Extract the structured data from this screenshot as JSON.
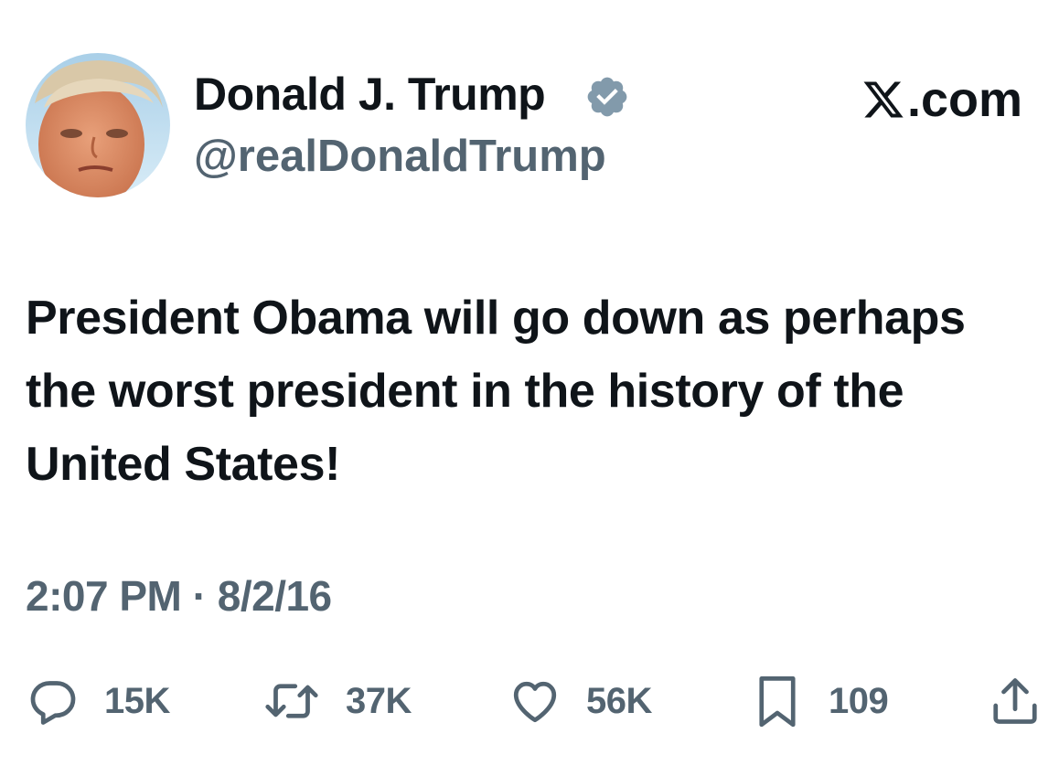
{
  "author": {
    "display_name": "Donald J. Trump",
    "handle": "@realDonaldTrump",
    "verified_icon": "verified-badge-icon",
    "verified_color": "#829aab"
  },
  "brand": {
    "label": ".com",
    "icon": "x-logo-icon"
  },
  "tweet": {
    "text": "President Obama will go down as perhaps the worst president in the history of the United States!",
    "time": "2:07 PM",
    "separator": "·",
    "date": "8/2/16"
  },
  "actions": {
    "replies": {
      "icon": "reply-icon",
      "count": "15K"
    },
    "retweets": {
      "icon": "retweet-icon",
      "count": "37K"
    },
    "likes": {
      "icon": "heart-icon",
      "count": "56K"
    },
    "bookmarks": {
      "icon": "bookmark-icon",
      "count": "109"
    },
    "share": {
      "icon": "share-icon"
    }
  },
  "colors": {
    "text_primary": "#0f1419",
    "text_secondary": "#536471",
    "background": "#ffffff"
  }
}
